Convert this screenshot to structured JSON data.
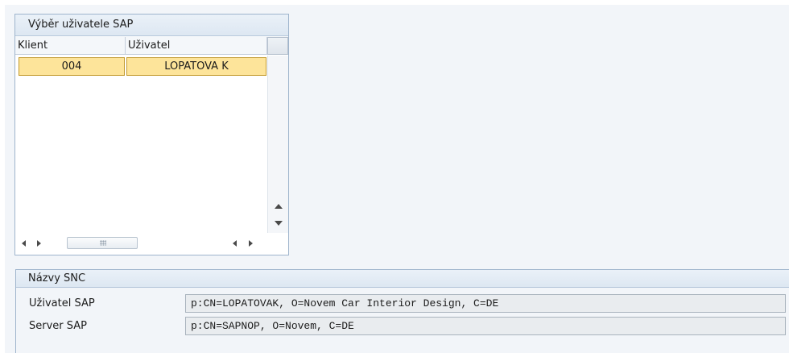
{
  "user_selection": {
    "title": "Výběr uživatele SAP",
    "columns": [
      "Klient",
      "Uživatel"
    ],
    "rows": [
      {
        "klient": "004",
        "uzivatel": "LOPATOVA K"
      }
    ],
    "vscroll_icons": {
      "up": "scroll-up-arrow",
      "down": "scroll-down-arrow"
    },
    "hscroll_icons": {
      "left": "scroll-left-arrow",
      "right": "scroll-right-arrow",
      "grip": "scroll-grip"
    }
  },
  "snc_names": {
    "title": "Názvy SNC",
    "sap_user_label": "Uživatel SAP",
    "sap_user_value": "p:CN=LOPATOVAK, O=Novem Car Interior Design, C=DE",
    "sap_server_label": "Server SAP",
    "sap_server_value": "p:CN=SAPNOP, O=Novem, C=DE"
  },
  "colors": {
    "panel_border": "#9eb4cc",
    "selected_row": "#fde49a",
    "background": "#f2f5f9"
  }
}
